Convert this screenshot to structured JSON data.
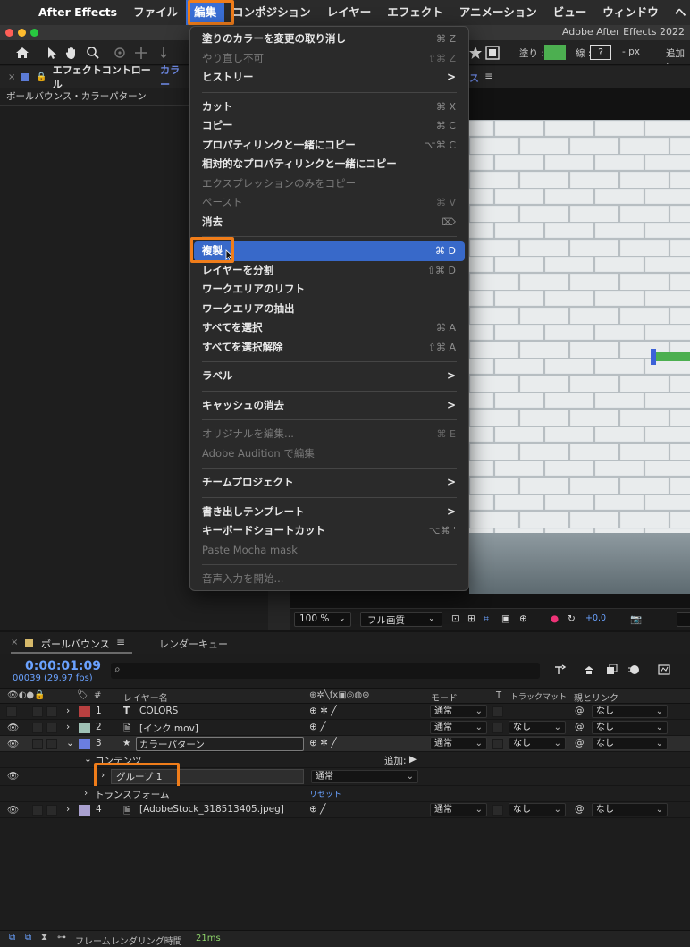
{
  "menubar": {
    "app": "After Effects",
    "items": [
      "ファイル",
      "編集",
      "コンポジション",
      "レイヤー",
      "エフェクト",
      "アニメーション",
      "ビュー",
      "ウィンドウ",
      "ヘ"
    ]
  },
  "window": {
    "title": "Adobe After Effects 2022"
  },
  "toolbar": {
    "fill_label": "塗り :",
    "stroke_label": "線 :",
    "stroke_value": "?",
    "px_label": "- px",
    "add_label": "追加 :",
    "fill_color": "#4caf50"
  },
  "effect_controls": {
    "tab_title": "エフェクトコントロール",
    "tab_layer": "カラー",
    "breadcrumb": "ボールバウンス・カラーパターン"
  },
  "comp_panel": {
    "tab_partial": "ス"
  },
  "edit_menu": {
    "items": [
      {
        "label": "塗りのカラーを変更の取り消し",
        "shortcut": "⌘ Z",
        "enabled": true
      },
      {
        "label": "やり直し不可",
        "shortcut": "⇧⌘ Z",
        "enabled": false
      },
      {
        "label": "ヒストリー",
        "submenu": ">",
        "enabled": true
      },
      {
        "label": "カット",
        "shortcut": "⌘ X",
        "enabled": true
      },
      {
        "label": "コピー",
        "shortcut": "⌘ C",
        "enabled": true
      },
      {
        "label": "プロパティリンクと一緒にコピー",
        "shortcut": "⌥⌘ C",
        "enabled": true
      },
      {
        "label": "相対的なプロパティリンクと一緒にコピー",
        "enabled": true
      },
      {
        "label": "エクスプレッションのみをコピー",
        "enabled": false
      },
      {
        "label": "ペースト",
        "shortcut": "⌘ V",
        "enabled": false
      },
      {
        "label": "消去",
        "shortcut": "⌦",
        "enabled": true
      },
      {
        "label": "複製",
        "shortcut": "⌘ D",
        "enabled": true
      },
      {
        "label": "レイヤーを分割",
        "shortcut": "⇧⌘ D",
        "enabled": true
      },
      {
        "label": "ワークエリアのリフト",
        "enabled": true
      },
      {
        "label": "ワークエリアの抽出",
        "enabled": true
      },
      {
        "label": "すべてを選択",
        "shortcut": "⌘ A",
        "enabled": true
      },
      {
        "label": "すべてを選択解除",
        "shortcut": "⇧⌘ A",
        "enabled": true
      },
      {
        "label": "ラベル",
        "submenu": ">",
        "enabled": true
      },
      {
        "label": "キャッシュの消去",
        "submenu": ">",
        "enabled": true
      },
      {
        "label": "オリジナルを編集...",
        "shortcut": "⌘ E",
        "enabled": false
      },
      {
        "label": "Adobe Audition で編集",
        "enabled": false
      },
      {
        "label": "チームプロジェクト",
        "submenu": ">",
        "enabled": true
      },
      {
        "label": "書き出しテンプレート",
        "submenu": ">",
        "enabled": true
      },
      {
        "label": "キーボードショートカット",
        "shortcut": "⌥⌘ '",
        "enabled": true
      },
      {
        "label": "Paste Mocha mask",
        "enabled": false
      },
      {
        "label": "音声入力を開始...",
        "enabled": false
      }
    ]
  },
  "viewer_bar": {
    "zoom": "100 %",
    "quality": "フル画質",
    "exposure": "+0.0"
  },
  "timeline": {
    "tab_title": "ボールバウンス",
    "tab_render": "レンダーキュー",
    "timecode": "0:00:01:09",
    "frames_fps": "00039 (29.97 fps)",
    "search_icon": "⌕",
    "columns": {
      "num": "#",
      "layer_name": "レイヤー名",
      "mode": "モード",
      "t": "T",
      "trkmat": "トラックマット",
      "parent": "親とリンク"
    },
    "layers": [
      {
        "num": "1",
        "name": "COLORS",
        "color": "#b84040",
        "mode": "通常",
        "trkmat": "",
        "parent": "なし"
      },
      {
        "num": "2",
        "name": "[インク.mov]",
        "color": "#9fc1b5",
        "mode": "通常",
        "trkmat": "なし",
        "parent": "なし"
      },
      {
        "num": "3",
        "name": "カラーパターン",
        "color": "#6a7ee0",
        "mode": "通常",
        "trkmat": "なし",
        "parent": "なし"
      },
      {
        "num": "4",
        "name": "[AdobeStock_318513405.jpeg]",
        "color": "#a9a0cf",
        "mode": "通常",
        "trkmat": "なし",
        "parent": "なし"
      }
    ],
    "contents_label": "コンテンツ",
    "add_label": "追加:",
    "group_label": "グループ 1",
    "group_mode": "通常",
    "transform_label": "トランスフォーム",
    "reset_label": "リセット"
  },
  "status_bar": {
    "label": "フレームレンダリング時間",
    "value": "21ms"
  },
  "colors": {
    "accent": "#3869c9",
    "highlight": "#f07d1a",
    "timecode": "#6aa2ff"
  }
}
